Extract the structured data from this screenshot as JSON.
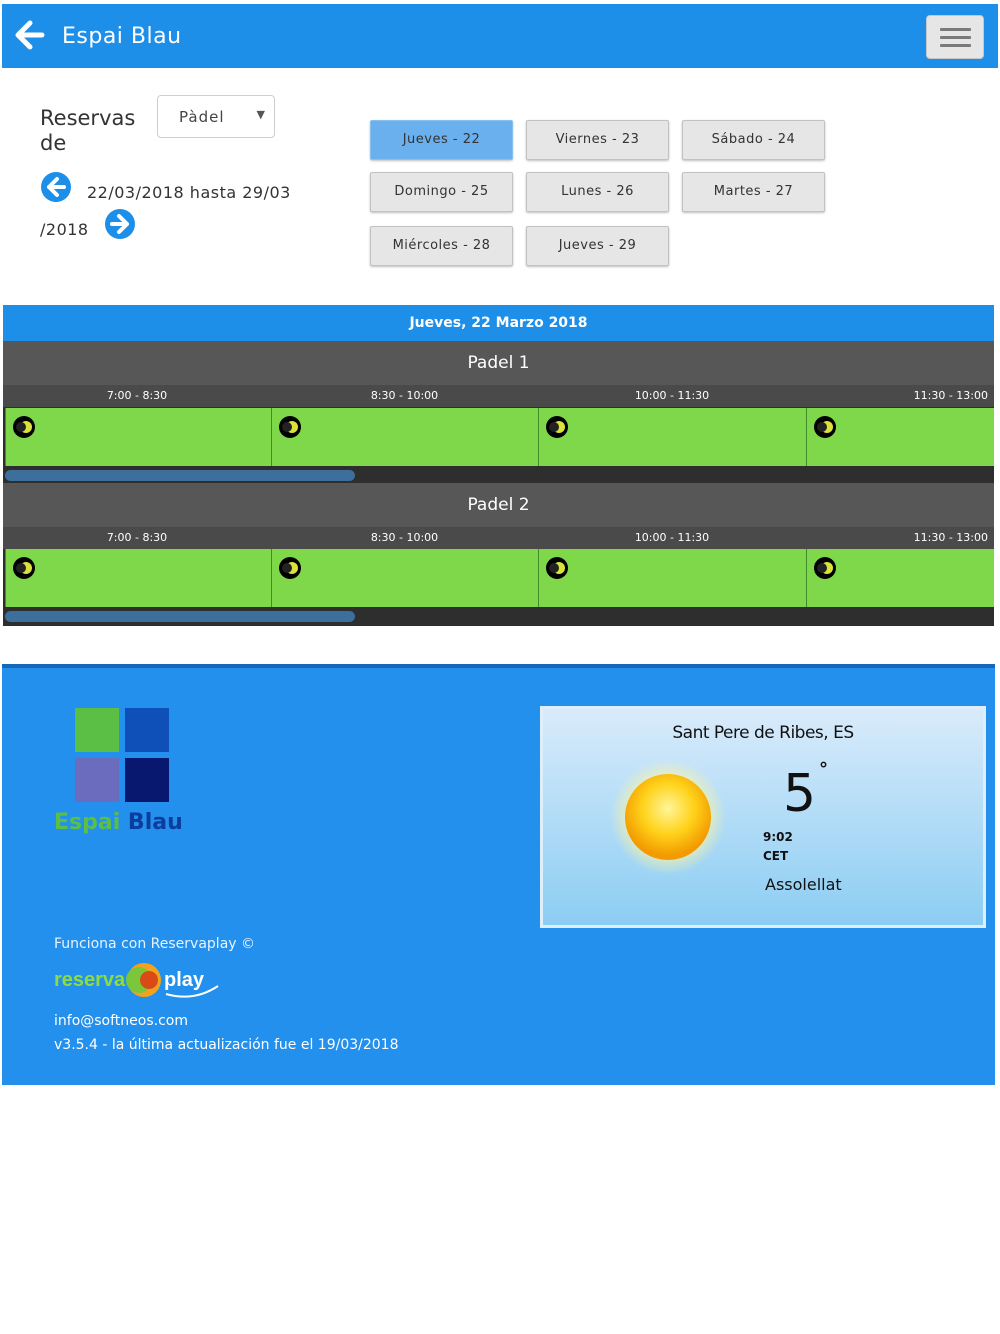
{
  "header": {
    "title": "Espai Blau"
  },
  "booking": {
    "reservas_label": "Reservas de",
    "sport_selected": "Pàdel",
    "range_line1": "22/03/2018 hasta 29/03",
    "range_line2": "/2018",
    "days": [
      {
        "label": "Jueves - 22",
        "active": true
      },
      {
        "label": "Viernes - 23",
        "active": false
      },
      {
        "label": "Sábado - 24",
        "active": false
      },
      {
        "label": "Domingo - 25",
        "active": false
      },
      {
        "label": "Lunes - 26",
        "active": false
      },
      {
        "label": "Martes - 27",
        "active": false
      },
      {
        "label": "Miércoles - 28",
        "active": false
      },
      {
        "label": "Jueves - 29",
        "active": false
      }
    ]
  },
  "schedule": {
    "date_title": "Jueves, 22 Marzo 2018",
    "courts": [
      {
        "name": "Padel 1",
        "slots": [
          "7:00 - 8:30",
          "8:30 - 10:00",
          "10:00 - 11:30",
          "11:30 - 13:00"
        ]
      },
      {
        "name": "Padel 2",
        "slots": [
          "7:00 - 8:30",
          "8:30 - 10:00",
          "10:00 - 11:30",
          "11:30 - 13:00"
        ]
      }
    ]
  },
  "footer": {
    "logo": {
      "text_part1": "Espai",
      "text_part2": " Blau"
    },
    "weather": {
      "location": "Sant Pere de Ribes, ES",
      "temperature": "5",
      "degree": "°",
      "time": "9:02",
      "timezone": "CET",
      "condition": "Assolellat"
    },
    "powered_by": "Funciona con Reservaplay ©",
    "reservaplay_logo": {
      "part1": "reserva",
      "part2": "play"
    },
    "email": "info@softneos.com",
    "version": "v3.5.4 - la última actualización fue el 19/03/2018"
  },
  "colors": {
    "primary": "#1e8fe8",
    "slot_available": "#7ed84a",
    "active_day": "#6ab0ee"
  }
}
